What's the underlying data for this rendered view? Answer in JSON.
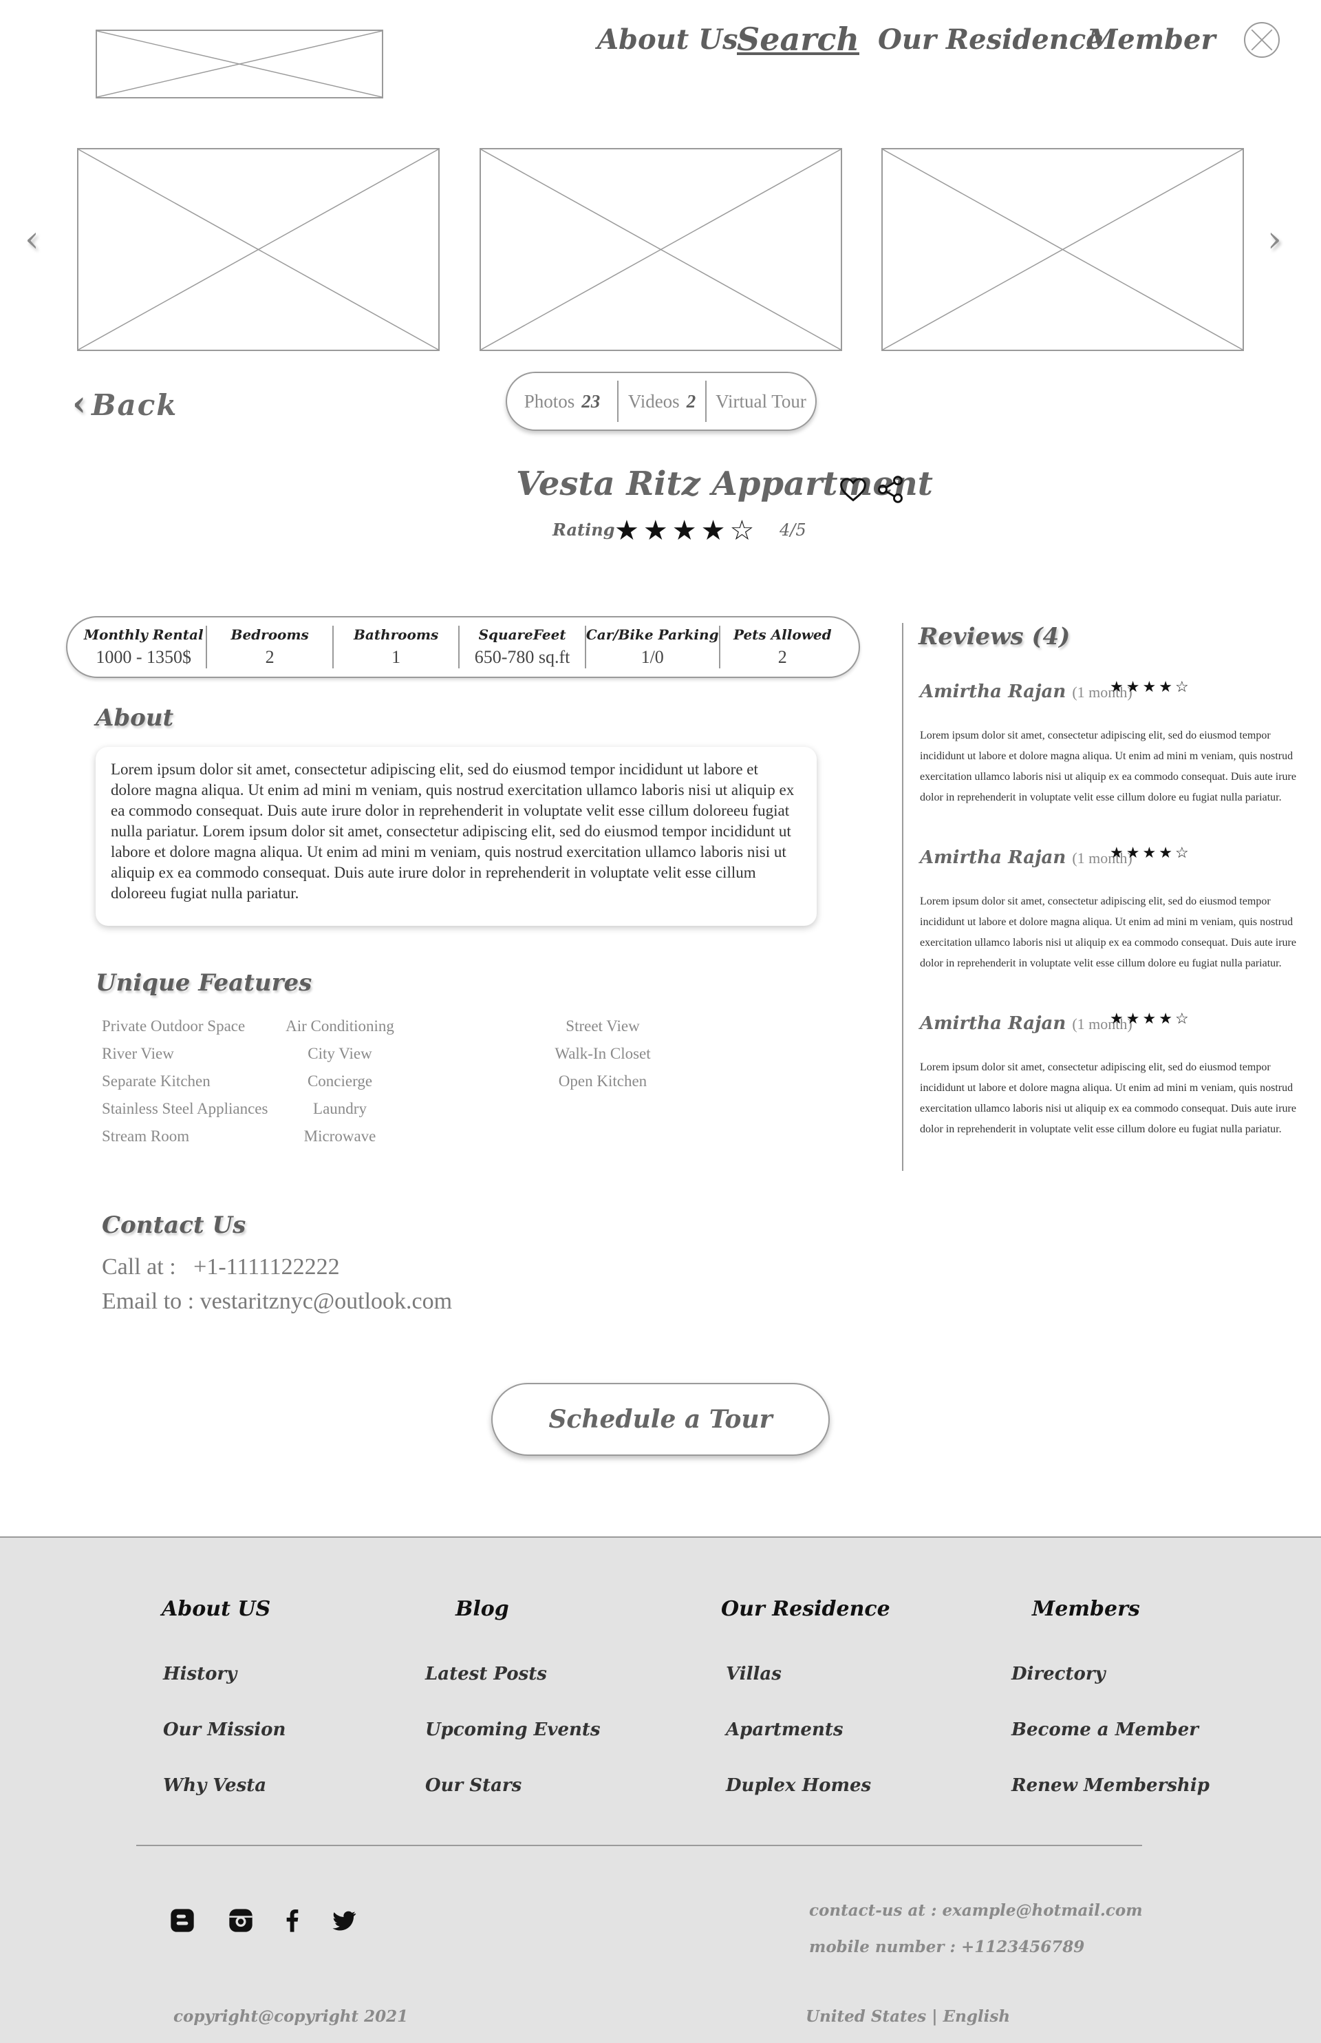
{
  "header": {
    "nav": [
      "About Us",
      "Search",
      "Our Residence",
      "Member"
    ],
    "active_nav": "Search",
    "back_label": "Back"
  },
  "media": {
    "photos_label": "Photos",
    "photos_count": "23",
    "videos_label": "Videos",
    "videos_count": "2",
    "tour_label": "Virtual Tour"
  },
  "listing": {
    "title": "Vesta Ritz Appartment",
    "rating_label": "Rating",
    "rating_value": 4,
    "rating_max": 5,
    "rating_text": "4/5"
  },
  "stats": [
    {
      "label": "Monthly Rental",
      "value": "1000 - 1350$"
    },
    {
      "label": "Bedrooms",
      "value": "2"
    },
    {
      "label": "Bathrooms",
      "value": "1"
    },
    {
      "label": "SquareFeet",
      "value": "650-780 sq.ft"
    },
    {
      "label": "Car/Bike Parking",
      "value": "1/0"
    },
    {
      "label": "Pets Allowed",
      "value": "2"
    }
  ],
  "about": {
    "heading": "About",
    "text": "Lorem ipsum dolor sit amet, consectetur adipiscing elit, sed do eiusmod tempor incididunt ut labore et dolore magna aliqua. Ut enim ad mini m veniam, quis nostrud exercitation ullamco laboris nisi ut aliquip ex ea  commodo consequat. Duis aute irure dolor in reprehenderit in voluptate velit esse cillum doloreeu fugiat nulla pariatur. Lorem ipsum dolor sit amet, consectetur adipiscing elit, sed do eiusmod tempor incididunt ut labore et dolore magna aliqua. Ut enim ad mini m veniam, quis nostrud exercitation ullamco laboris nisi ut aliquip ex ea  commodo consequat. Duis aute irure dolor in reprehenderit in voluptate velit esse cillum doloreeu fugiat nulla pariatur."
  },
  "features": {
    "heading": "Unique Features",
    "col1": [
      "Private Outdoor Space",
      "River View",
      "Separate Kitchen",
      "Stainless Steel Appliances",
      "Stream Room"
    ],
    "col2": [
      "Air Conditioning",
      "City View",
      "Concierge",
      "Laundry",
      "Microwave"
    ],
    "col3": [
      "Street View",
      "Walk-In Closet",
      "Open Kitchen"
    ]
  },
  "contact": {
    "heading": "Contact Us",
    "call_label": "Call at :",
    "phone": "+1-1111122222",
    "email_label": "Email to :",
    "email": "vestaritznyc@outlook.com"
  },
  "schedule_label": "Schedule a Tour",
  "reviews": {
    "heading": "Reviews (4)",
    "items": [
      {
        "name": "Amirtha Rajan",
        "age": "(1 month)",
        "stars": 4,
        "text": "Lorem ipsum dolor sit amet, consectetur adipiscing elit, sed do eiusmod tempor incididunt ut labore et dolore magna aliqua. Ut enim ad mini m veniam, quis nostrud exercitation ullamco laboris nisi ut aliquip ex ea  commodo consequat. Duis aute irure dolor in reprehenderit in voluptate velit esse cillum dolore eu fugiat nulla pariatur."
      },
      {
        "name": "Amirtha Rajan",
        "age": "(1 month)",
        "stars": 4,
        "text": "Lorem ipsum dolor sit amet, consectetur adipiscing elit, sed do eiusmod tempor incididunt ut labore et dolore magna aliqua. Ut enim ad mini m veniam, quis nostrud exercitation ullamco laboris nisi ut aliquip ex ea  commodo consequat. Duis aute irure dolor in reprehenderit in voluptate velit esse cillum dolore eu fugiat nulla pariatur."
      },
      {
        "name": "Amirtha Rajan",
        "age": "(1 month)",
        "stars": 4,
        "text": "Lorem ipsum dolor sit amet, consectetur adipiscing elit, sed do eiusmod tempor incididunt ut labore et dolore magna aliqua. Ut enim ad mini m veniam, quis nostrud exercitation ullamco laboris nisi ut aliquip ex ea  commodo consequat. Duis aute irure dolor in reprehenderit in voluptate velit esse cillum dolore eu fugiat nulla pariatur."
      }
    ]
  },
  "footer": {
    "columns": [
      {
        "heading": "About US",
        "links": [
          "History",
          "Our Mission",
          "Why Vesta"
        ]
      },
      {
        "heading": "Blog",
        "links": [
          "Latest Posts",
          "Upcoming Events",
          "Our Stars"
        ]
      },
      {
        "heading": "Our Residence",
        "links": [
          "Villas",
          "Apartments",
          "Duplex Homes"
        ]
      },
      {
        "heading": "Members",
        "links": [
          "Directory",
          "Become a Member",
          "Renew Membership"
        ]
      }
    ],
    "contact_email": "contact-us at : example@hotmail.com",
    "mobile": "mobile number : +1123456789",
    "copyright": "copyright@copyright 2021",
    "locale": "United States | English",
    "social_icons": [
      "blogger-icon",
      "instagram-icon",
      "facebook-icon",
      "twitter-icon"
    ]
  }
}
